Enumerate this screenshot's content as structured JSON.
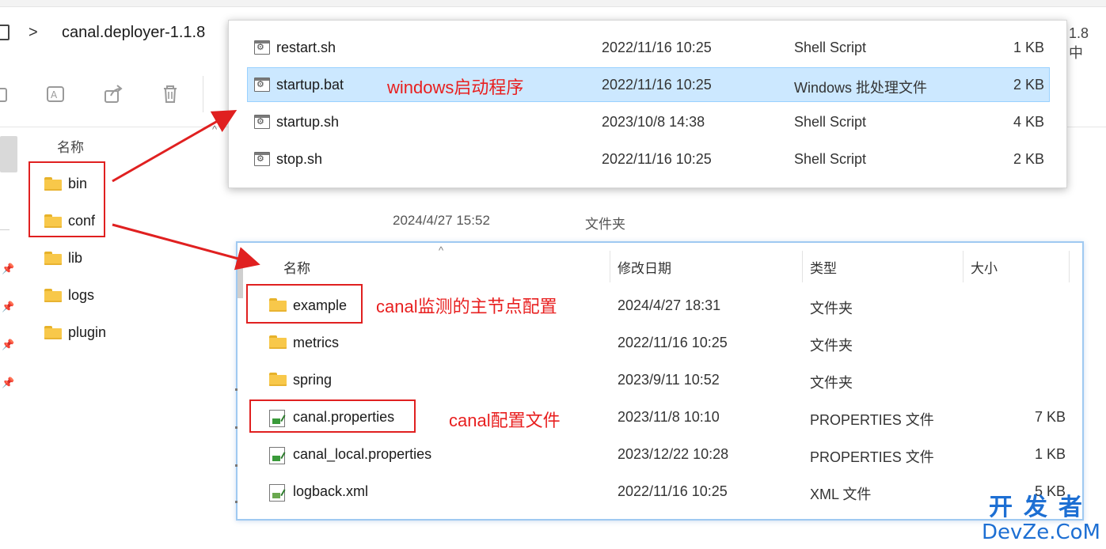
{
  "address": {
    "separator": ">",
    "path": "canal.deployer-1.1.8",
    "trailing": "1.8 中"
  },
  "left_pane": {
    "column_name": "名称",
    "folders": [
      {
        "name": "bin",
        "icon": "folder-icon"
      },
      {
        "name": "conf",
        "icon": "folder-icon"
      },
      {
        "name": "lib",
        "icon": "folder-icon"
      },
      {
        "name": "logs",
        "icon": "folder-icon"
      },
      {
        "name": "plugin",
        "icon": "folder-icon"
      }
    ],
    "partial_rows": [
      {
        "date": "2024/4/27 15:52",
        "type": "文件夹"
      }
    ]
  },
  "bin_popup": {
    "files": [
      {
        "name": "restart.sh",
        "date": "2022/11/16 10:25",
        "type": "Shell Script",
        "size": "1 KB",
        "icon": "script-icon"
      },
      {
        "name": "startup.bat",
        "date": "2022/11/16 10:25",
        "type": "Windows 批处理文件",
        "size": "2 KB",
        "icon": "script-icon",
        "selected": true
      },
      {
        "name": "startup.sh",
        "date": "2023/10/8 14:38",
        "type": "Shell Script",
        "size": "4 KB",
        "icon": "script-icon"
      },
      {
        "name": "stop.sh",
        "date": "2022/11/16 10:25",
        "type": "Shell Script",
        "size": "2 KB",
        "icon": "script-icon"
      }
    ]
  },
  "conf_popup": {
    "headers": {
      "name": "名称",
      "date": "修改日期",
      "type": "类型",
      "size": "大小"
    },
    "files": [
      {
        "name": "example",
        "date": "2024/4/27 18:31",
        "type": "文件夹",
        "size": "",
        "icon": "folder-icon"
      },
      {
        "name": "metrics",
        "date": "2022/11/16 10:25",
        "type": "文件夹",
        "size": "",
        "icon": "folder-icon"
      },
      {
        "name": "spring",
        "date": "2023/9/11 10:52",
        "type": "文件夹",
        "size": "",
        "icon": "folder-icon"
      },
      {
        "name": "canal.properties",
        "date": "2023/11/8 10:10",
        "type": "PROPERTIES 文件",
        "size": "7 KB",
        "icon": "properties-icon"
      },
      {
        "name": "canal_local.properties",
        "date": "2023/12/22 10:28",
        "type": "PROPERTIES 文件",
        "size": "1 KB",
        "icon": "properties-icon"
      },
      {
        "name": "logback.xml",
        "date": "2022/11/16 10:25",
        "type": "XML 文件",
        "size": "5 KB",
        "icon": "xml-icon"
      }
    ]
  },
  "annotations": {
    "windows_startup": "windows启动程序",
    "example_note": "canal监测的主节点配置",
    "properties_note": "canal配置文件",
    "color": "#e81f1f"
  },
  "watermark": {
    "cn": "开发者",
    "en": "DevZe.CoM",
    "color": "#1d6fd3"
  }
}
